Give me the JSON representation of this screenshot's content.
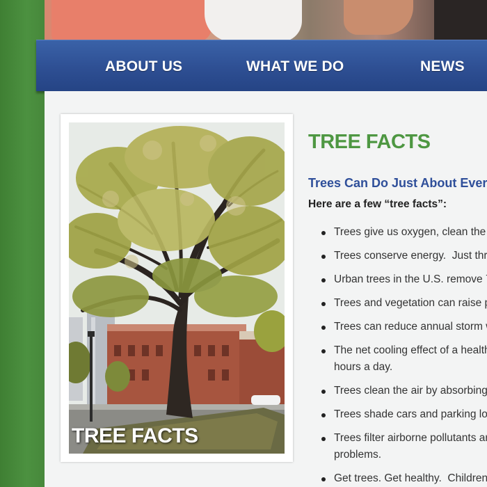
{
  "nav": {
    "items": [
      {
        "label": "ABOUT US"
      },
      {
        "label": "WHAT WE DO"
      },
      {
        "label": "NEWS"
      }
    ]
  },
  "photo": {
    "caption": "TREE FACTS"
  },
  "main": {
    "title": "TREE FACTS",
    "subtitle": "Trees Can Do Just About Every",
    "intro": "Here are a few “tree facts”:",
    "facts": [
      {
        "lines": [
          "Trees give us oxygen, clean the a"
        ]
      },
      {
        "lines": [
          "Trees conserve energy.  Just thr"
        ]
      },
      {
        "lines": [
          "Urban trees in the U.S. remove 7"
        ]
      },
      {
        "lines": [
          "Trees and vegetation can raise p"
        ]
      },
      {
        "lines": [
          "Trees can reduce annual storm w"
        ]
      },
      {
        "lines": [
          "The net cooling effect of a health",
          "hours a day."
        ]
      },
      {
        "lines": [
          "Trees clean the air by absorbing"
        ]
      },
      {
        "lines": [
          "Trees shade cars and parking lot"
        ]
      },
      {
        "lines": [
          "Trees filter airborne pollutants ar",
          "problems."
        ]
      },
      {
        "lines": [
          "Get trees. Get healthy.  Children"
        ]
      }
    ]
  },
  "colors": {
    "green_side": "#4a8a3c",
    "nav_blue": "#2e4f93",
    "title_green": "#4e9742",
    "subtitle_blue": "#2f4f9a"
  }
}
